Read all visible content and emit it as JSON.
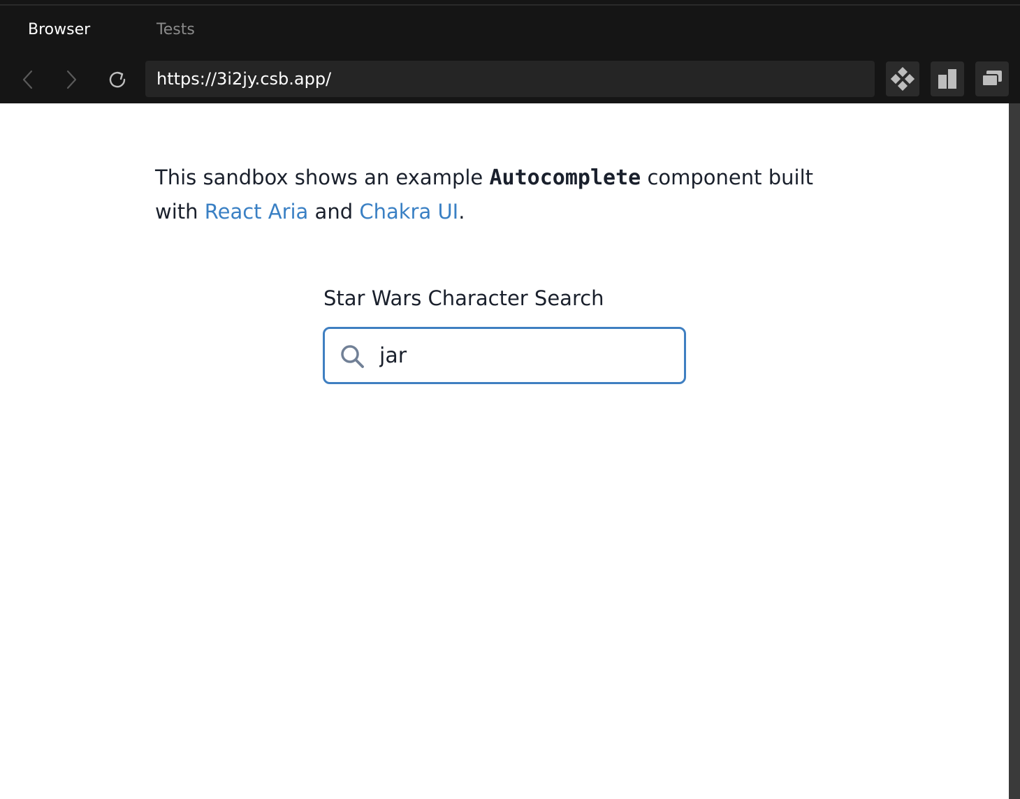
{
  "tabs": [
    {
      "label": "Browser",
      "active": true
    },
    {
      "label": "Tests",
      "active": false
    }
  ],
  "navbar": {
    "url": "https://3i2jy.csb.app/"
  },
  "content": {
    "intro_before_code": "This sandbox shows an example ",
    "intro_code": "Autocomplete",
    "intro_after_code": " component built with ",
    "link_react_aria": "React Aria",
    "intro_and": " and ",
    "link_chakra": "Chakra UI",
    "intro_end": ".",
    "search_label": "Star Wars Character Search",
    "search_value": "jar"
  },
  "colors": {
    "chrome_bg": "#151515",
    "link": "#3a80c4",
    "focus_border": "#3f7fc1",
    "text": "#1a202c"
  },
  "icons": {
    "back": "chevron-left-icon",
    "forward": "chevron-right-icon",
    "reload": "reload-icon",
    "tool1": "codesandbox-diamond-icon",
    "tool2": "split-pane-icon",
    "tool3": "new-window-icon",
    "search": "search-icon"
  }
}
